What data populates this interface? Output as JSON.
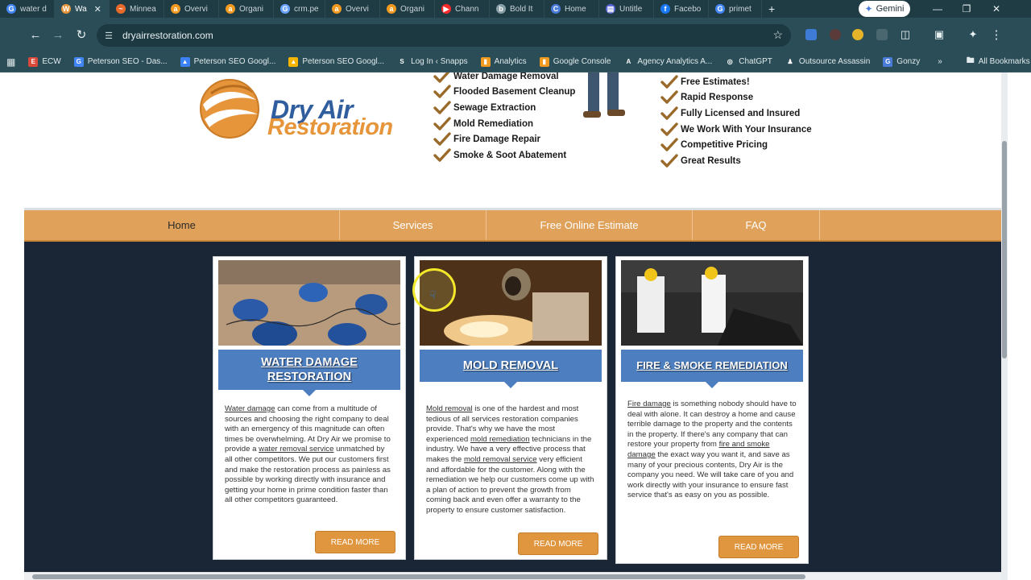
{
  "browser": {
    "tabs": [
      {
        "label": "water d",
        "icon": "google-icon",
        "color": "#4285f4",
        "glyph": "G"
      },
      {
        "label": "Wa",
        "icon": "site-icon",
        "color": "#e6953a",
        "glyph": "W"
      },
      {
        "label": "Minnea",
        "icon": "site-icon",
        "color": "#e86a2b",
        "glyph": "~"
      },
      {
        "label": "Overvi",
        "icon": "ahrefs-icon",
        "color": "#f29a1f",
        "glyph": "a"
      },
      {
        "label": "Organi",
        "icon": "ahrefs-icon",
        "color": "#f29a1f",
        "glyph": "a"
      },
      {
        "label": "crm.pe",
        "icon": "search-icon",
        "color": "#6aa3ff",
        "glyph": "G"
      },
      {
        "label": "Overvi",
        "icon": "ahrefs-icon",
        "color": "#f29a1f",
        "glyph": "a"
      },
      {
        "label": "Organi",
        "icon": "ahrefs-icon",
        "color": "#f29a1f",
        "glyph": "a"
      },
      {
        "label": "Chann",
        "icon": "youtube-icon",
        "color": "#ff2b2b",
        "glyph": "▶"
      },
      {
        "label": "Bold It",
        "icon": "site-icon",
        "color": "#8aa0a8",
        "glyph": "b"
      },
      {
        "label": "Home",
        "icon": "site-icon",
        "color": "#4a7bd9",
        "glyph": "C"
      },
      {
        "label": "Untitle",
        "icon": "site-icon",
        "color": "#5a68d8",
        "glyph": "▤"
      },
      {
        "label": "Facebo",
        "icon": "facebook-icon",
        "color": "#1877f2",
        "glyph": "f"
      },
      {
        "label": "primet",
        "icon": "google-icon",
        "color": "#4285f4",
        "glyph": "G"
      }
    ],
    "new_tab": "+",
    "gemini_label": "Gemini",
    "url": "dryairrestoration.com",
    "bookmarks": [
      {
        "label": "ECW",
        "color": "#d94a3a",
        "glyph": "E"
      },
      {
        "label": "Peterson SEO - Das...",
        "color": "#4285f4",
        "glyph": "G"
      },
      {
        "label": "Peterson SEO Googl...",
        "color": "#3b82f6",
        "glyph": "▲"
      },
      {
        "label": "Peterson SEO Googl...",
        "color": "#f4b400",
        "glyph": "▲"
      },
      {
        "label": "Log In ‹ Snapps",
        "color": "#2b4d57",
        "glyph": "S"
      },
      {
        "label": "Analytics",
        "color": "#f29a1f",
        "glyph": "▮"
      },
      {
        "label": "Google Console",
        "color": "#f29a1f",
        "glyph": "▮"
      },
      {
        "label": "Agency Analytics A...",
        "color": "#2b4d57",
        "glyph": "A"
      },
      {
        "label": "ChatGPT",
        "color": "#2b4d57",
        "glyph": "◎"
      },
      {
        "label": "Outsource Assassin",
        "color": "#2b4d57",
        "glyph": "♟"
      },
      {
        "label": "Gonzy",
        "color": "#4a7bd9",
        "glyph": "G"
      }
    ],
    "all_bookmarks": "All Bookmarks"
  },
  "site": {
    "logo": {
      "line1": "Dry Air",
      "line2": "Restoration"
    },
    "services_list": [
      "Water Damage Removal",
      "Flooded Basement Cleanup",
      "Sewage Extraction",
      "Mold Remediation",
      "Fire Damage Repair",
      "Smoke & Soot Abatement"
    ],
    "benefits_list": [
      "Free Estimates!",
      "Rapid Response",
      "Fully Licensed and Insured",
      "We Work With Your Insurance",
      "Competitive Pricing",
      "Great Results"
    ],
    "nav": [
      "Home",
      "Services",
      "Free Online Estimate",
      "FAQ"
    ],
    "cards": [
      {
        "title_line1": "WATER DAMAGE",
        "title_line2": "RESTORATION",
        "link1": "Water damage",
        "text1": " can come from a multitude of sources and choosing the right company to deal with an emergency of this magnitude can often times be overwhelming. At Dry Air we promise to provide a ",
        "link2": "water removal service",
        "text2": " unmatched by all other competitors. We put our customers first and make the restoration process as painless as possible by working directly with insurance and getting your home in prime condition faster than all other competitors guaranteed.",
        "button": "READ MORE"
      },
      {
        "title_line1": "MOLD REMOVAL",
        "title_line2": "",
        "link1": "Mold removal",
        "text1": " is one of the hardest and most tedious of all services restoration companies provide. That's why we have the most experienced ",
        "link2": "mold remediation",
        "text2": " technicians in the industry. We have a very effective process that makes the ",
        "link3": "mold removal service",
        "text3": " very efficient and affordable for the customer. Along with the remediation we help our customers come up with a plan of action to prevent the growth from coming back and even offer a warranty to the property to ensure customer satisfaction.",
        "button": "READ MORE"
      },
      {
        "title_line1": "FIRE & SMOKE REMEDIATION",
        "title_line2": "",
        "link1": "Fire damage",
        "text1": " is something nobody should have to deal with alone. It can destroy a home and cause terrible damage to the property and the contents in the property. If there's any company that can restore your property from ",
        "link2": "fire and smoke damage",
        "text2": " the exact way you want it, and save as many of your precious contents, Dry Air is the company you need. We will take care of you and work directly with your insurance to ensure fast service that's as easy on you as possible.",
        "button": "READ MORE"
      }
    ]
  }
}
